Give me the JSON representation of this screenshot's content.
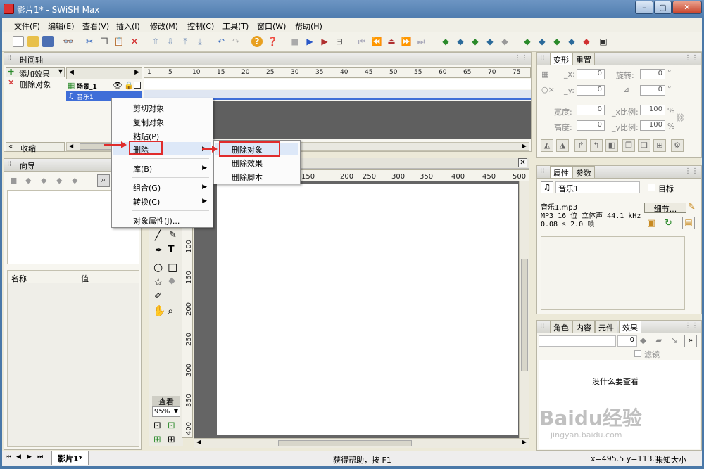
{
  "window": {
    "title": "影片1* - SWiSH Max",
    "min": "–",
    "max": "▢",
    "close": "✕"
  },
  "menu": [
    "文件(F)",
    "编辑(E)",
    "查看(V)",
    "插入(I)",
    "修改(M)",
    "控制(C)",
    "工具(T)",
    "窗口(W)",
    "帮助(H)"
  ],
  "timeline": {
    "tab": "时间轴",
    "add_effect": "添加效果",
    "delete_object": "删除对象",
    "collapse": "收缩",
    "scene_label": "场景_1",
    "music_label": "音乐1",
    "ruler": [
      "1",
      "5",
      "10",
      "15",
      "20",
      "25",
      "30",
      "35",
      "40",
      "45",
      "50",
      "55",
      "60",
      "65",
      "70",
      "75"
    ]
  },
  "guide": {
    "tab": "向导",
    "col_name": "名称",
    "col_value": "值"
  },
  "context_menu": {
    "items": [
      "剪切对象",
      "复制对象",
      "粘贴(P)",
      "删除",
      "库(B)",
      "组合(G)",
      "转换(C)",
      "对象属性(J)..."
    ],
    "submenu": [
      "删除对象",
      "删除效果",
      "删除脚本"
    ]
  },
  "stage": {
    "h_ruler": [
      "150",
      "200",
      "250",
      "300",
      "350",
      "400",
      "450",
      "500"
    ],
    "v_ruler": [
      "100",
      "150",
      "200",
      "250",
      "300",
      "350",
      "400"
    ],
    "view_label": "查看",
    "zoom": "95%"
  },
  "transform": {
    "tabs": [
      "变形",
      "重置"
    ],
    "x_label": "_x:",
    "y_label": "_y:",
    "x_val": "0",
    "y_val": "0",
    "rot_label": "旋转:",
    "rot_val": "0",
    "skew_val": "0",
    "w_label": "宽度:",
    "h_label": "高度:",
    "w_val": "0",
    "h_val": "0",
    "xs_label": "_x比例:",
    "ys_label": "_y比例:",
    "xs_val": "100",
    "ys_val": "100",
    "pct": "%",
    "deg": "°"
  },
  "properties": {
    "tabs": [
      "属性",
      "参数"
    ],
    "name": "音乐1",
    "target_label": "目标",
    "file_line": "音乐1.mp3",
    "info_line1": "MP3 16 位 立体声 44.1 kHz",
    "info_line2": "0.08 s 2.0 帧",
    "detail_button": "细节..."
  },
  "effects_panel": {
    "tabs": [
      "角色",
      "内容",
      "元件",
      "效果"
    ],
    "value": "0",
    "filter_label": "滤镜",
    "empty_msg": "没什么要查看"
  },
  "status": {
    "doc_tab": "影片1*",
    "help": "获得帮助，按 F1",
    "coords": "x=495.5 y=113.1",
    "size": "未知大小"
  },
  "watermark": {
    "main": "Baidu经验",
    "sub": "jingyan.baidu.com"
  }
}
